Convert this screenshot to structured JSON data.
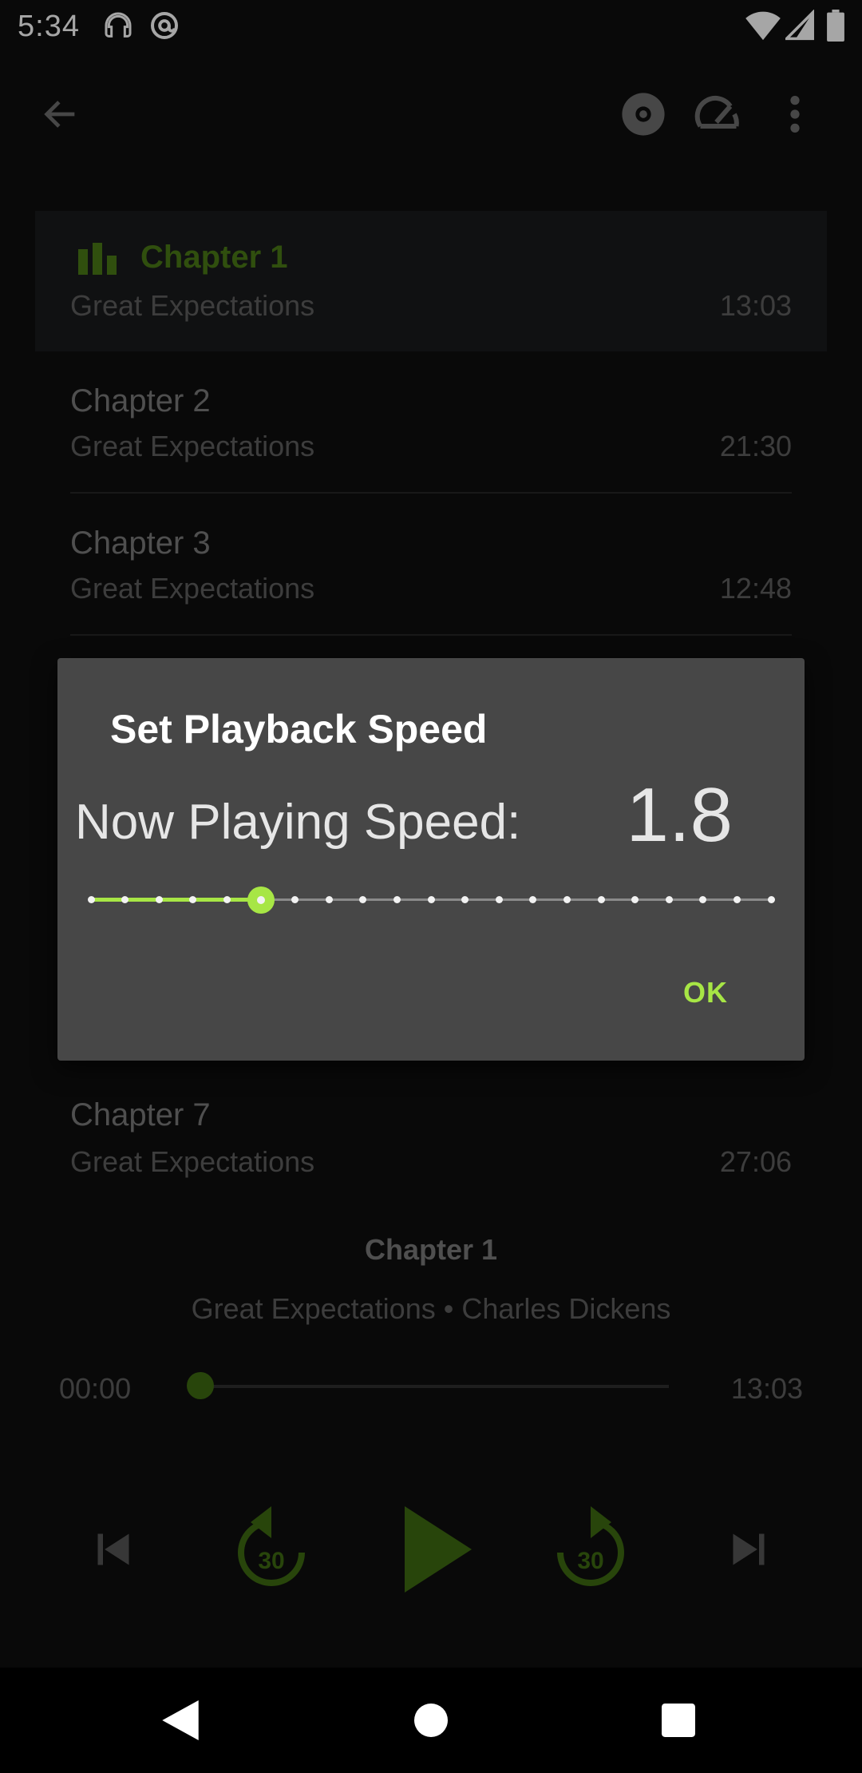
{
  "status_bar": {
    "time": "5:34",
    "left_icons": [
      "headset-icon",
      "at-sign-icon"
    ],
    "right_icons": [
      "wifi-icon",
      "signal-icon",
      "battery-icon"
    ]
  },
  "app_bar": {
    "icons": [
      "back-arrow-icon",
      "disc-icon",
      "speedometer-icon",
      "more-vert-icon"
    ]
  },
  "chapters": [
    {
      "title": "Chapter 1",
      "subtitle": "Great Expectations",
      "duration": "13:03",
      "active": true
    },
    {
      "title": "Chapter 2",
      "subtitle": "Great Expectations",
      "duration": "21:30",
      "active": false
    },
    {
      "title": "Chapter 3",
      "subtitle": "Great Expectations",
      "duration": "12:48",
      "active": false
    },
    {
      "title": "Chapter 7",
      "subtitle": "Great Expectations",
      "duration": "27:06",
      "active": false
    }
  ],
  "dialog": {
    "title": "Set Playback Speed",
    "label": "Now Playing Speed:",
    "value": "1.8",
    "slider": {
      "steps": 21,
      "selected_index": 5,
      "fill_fraction": 0.25
    },
    "ok_label": "OK"
  },
  "now_playing": {
    "title": "Chapter 1",
    "subtitle": "Great Expectations • Charles Dickens",
    "elapsed": "00:00",
    "total": "13:03",
    "progress": 0
  },
  "controls": {
    "rewind_label": "30",
    "forward_label": "30",
    "icons": [
      "skip-previous-icon",
      "rewind-30-icon",
      "play-icon",
      "forward-30-icon",
      "skip-next-icon"
    ]
  },
  "colors": {
    "accent": "#a7e645",
    "accent_dim": "#4a7a16",
    "background": "#0e0e0e",
    "dialog": "#474747"
  }
}
